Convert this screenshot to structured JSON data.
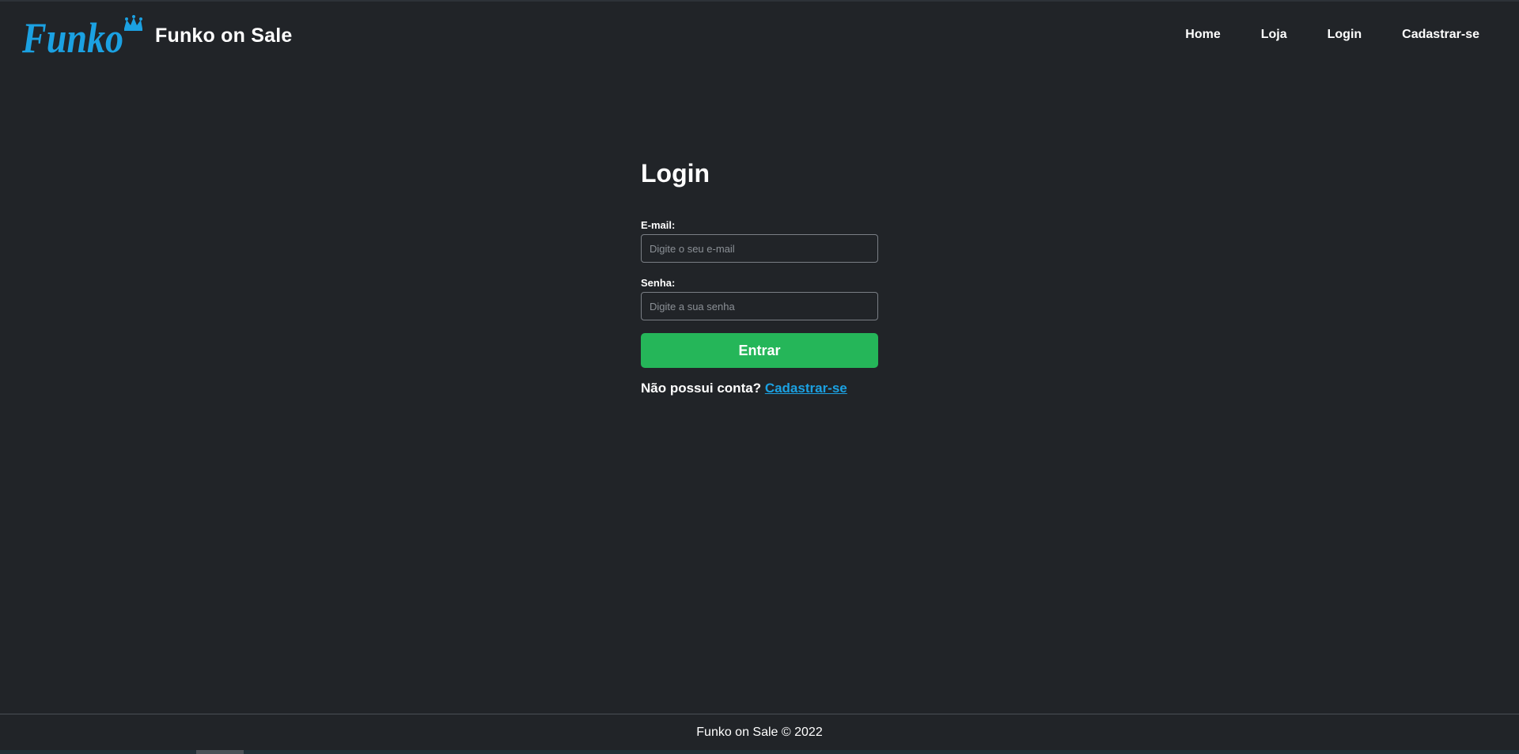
{
  "header": {
    "logo_text": "Funko",
    "title": "Funko on Sale",
    "nav": [
      {
        "label": "Home"
      },
      {
        "label": "Loja"
      },
      {
        "label": "Login"
      },
      {
        "label": "Cadastrar-se"
      }
    ]
  },
  "login": {
    "heading": "Login",
    "email_label": "E-mail:",
    "email_placeholder": "Digite o seu e-mail",
    "email_value": "",
    "password_label": "Senha:",
    "password_placeholder": "Digite a sua senha",
    "password_value": "",
    "submit_label": "Entrar",
    "no_account_text": "Não possui conta?",
    "signup_link": "Cadastrar-se"
  },
  "footer": {
    "text": "Funko on Sale © 2022"
  },
  "colors": {
    "background": "#212428",
    "brand_blue": "#1ba1e2",
    "button_green": "#25b659",
    "text": "#ffffff"
  },
  "icons": {
    "logo": "funko-crown-logo"
  }
}
